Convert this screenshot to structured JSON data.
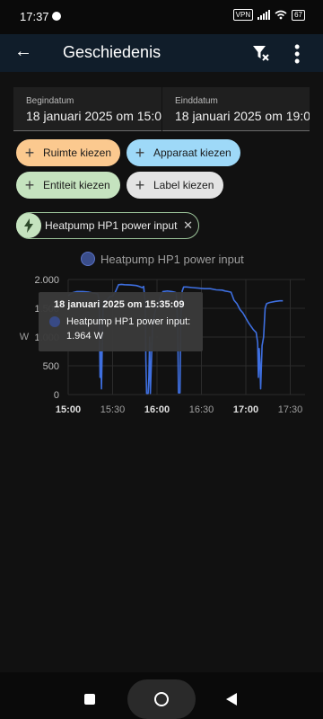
{
  "status": {
    "time": "17:37",
    "vpn": "VPN",
    "battery": "67"
  },
  "appbar": {
    "title": "Geschiedenis"
  },
  "dates": {
    "start_label": "Begindatum",
    "start_value": "18 januari 2025 om 15:0",
    "end_label": "Einddatum",
    "end_value": "18 januari 2025 om 19:0"
  },
  "chips": {
    "room": "Ruimte kiezen",
    "device": "Apparaat kiezen",
    "entity": "Entiteit kiezen",
    "label": "Label kiezen",
    "selected_entity": "Heatpump HP1 power input"
  },
  "colors": {
    "chip_room": "#fbc98f",
    "chip_device": "#9ed9f8",
    "chip_entity": "#c5e3bf",
    "chip_label": "#e4e4e4",
    "series": "#3e6fe0"
  },
  "chart_data": {
    "type": "line",
    "legend": "Heatpump HP1 power input",
    "ylabel": "W",
    "yticks": [
      "0",
      "500",
      "1.000",
      "1.500",
      "2.000"
    ],
    "ylim": [
      0,
      2000
    ],
    "xticks": [
      "15:00",
      "15:30",
      "16:00",
      "16:30",
      "17:00",
      "17:30"
    ],
    "xlim_minutes": [
      0,
      160
    ],
    "series": [
      {
        "name": "Heatpump HP1 power input",
        "points": [
          [
            0,
            1720
          ],
          [
            3,
            1770
          ],
          [
            6,
            1790
          ],
          [
            10,
            1790
          ],
          [
            14,
            1780
          ],
          [
            18,
            1760
          ],
          [
            20,
            1750
          ],
          [
            21,
            1620
          ],
          [
            21.5,
            300
          ],
          [
            22,
            750
          ],
          [
            22.5,
            100
          ],
          [
            23,
            800
          ],
          [
            23.5,
            1500
          ],
          [
            24,
            1610
          ],
          [
            26,
            1640
          ],
          [
            28,
            1700
          ],
          [
            30,
            1710
          ],
          [
            32,
            1790
          ],
          [
            34,
            1910
          ],
          [
            36,
            1915
          ],
          [
            38,
            1910
          ],
          [
            42,
            1905
          ],
          [
            46,
            1895
          ],
          [
            48,
            1880
          ],
          [
            50,
            1860
          ],
          [
            51,
            1880
          ],
          [
            52,
            1600
          ],
          [
            52.5,
            600
          ],
          [
            53,
            20
          ],
          [
            54,
            20
          ],
          [
            54.5,
            300
          ],
          [
            55,
            1000
          ],
          [
            55.5,
            20
          ],
          [
            56,
            400
          ],
          [
            57,
            1230
          ],
          [
            59,
            1480
          ],
          [
            62,
            1680
          ],
          [
            64,
            1790
          ],
          [
            67,
            1800
          ],
          [
            70,
            1790
          ],
          [
            72,
            1780
          ],
          [
            73,
            1770
          ],
          [
            74,
            1200
          ],
          [
            74.5,
            30
          ],
          [
            75.5,
            30
          ],
          [
            76,
            1300
          ],
          [
            77,
            1800
          ],
          [
            78,
            1870
          ],
          [
            80,
            1870
          ],
          [
            84,
            1860
          ],
          [
            88,
            1850
          ],
          [
            92,
            1840
          ],
          [
            96,
            1840
          ],
          [
            100,
            1820
          ],
          [
            104,
            1815
          ],
          [
            106,
            1800
          ],
          [
            108,
            1790
          ],
          [
            110,
            1780
          ],
          [
            112,
            1640
          ],
          [
            114,
            1580
          ],
          [
            116,
            1480
          ],
          [
            118,
            1420
          ],
          [
            120,
            1330
          ],
          [
            122,
            1240
          ],
          [
            125,
            1130
          ],
          [
            127,
            1080
          ],
          [
            128,
            900
          ],
          [
            128.5,
            300
          ],
          [
            129,
            800
          ],
          [
            129.5,
            550
          ],
          [
            130,
            100
          ],
          [
            131,
            850
          ],
          [
            132,
            1000
          ],
          [
            133,
            1500
          ],
          [
            134,
            1580
          ],
          [
            136,
            1600
          ],
          [
            140,
            1620
          ],
          [
            143,
            1630
          ],
          [
            145,
            1630
          ]
        ]
      }
    ]
  },
  "tooltip": {
    "title": "18 januari 2025 om 15:35:09",
    "line1": "Heatpump HP1 power input:",
    "line2": "1.964 W"
  }
}
